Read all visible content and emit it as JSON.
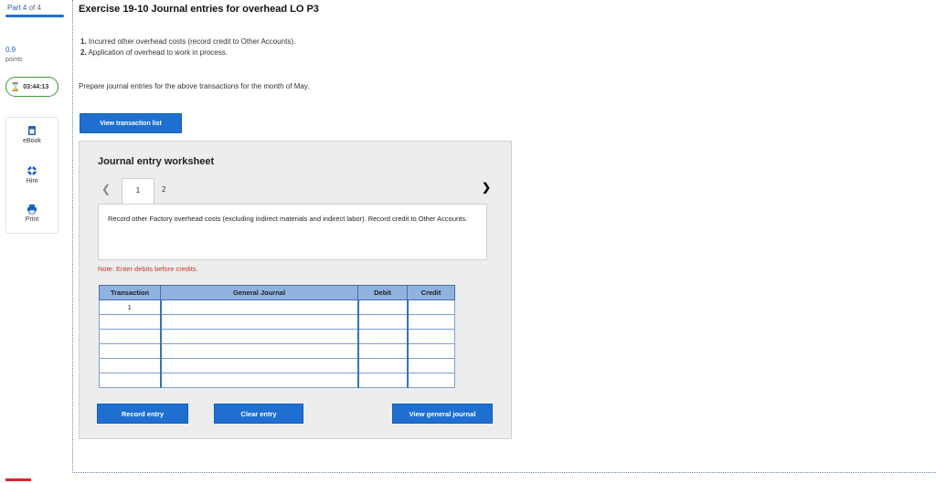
{
  "sidebar": {
    "part_prefix": "Part 4",
    "part_suffix": "of 4",
    "points_value": "0.9",
    "points_label": "points",
    "timer": "03:44:13",
    "progress_fraction": 1.0,
    "tools": [
      {
        "label": "eBook",
        "icon": "book-icon"
      },
      {
        "label": "Hint",
        "icon": "lifebuoy-icon"
      },
      {
        "label": "Print",
        "icon": "printer-icon"
      }
    ]
  },
  "main": {
    "title": "Exercise 19-10 Journal entries for overhead LO P3",
    "instructions": [
      {
        "num": "1.",
        "text": "Incurred other overhead costs (record credit to Other Accounts)."
      },
      {
        "num": "2.",
        "text": "Application of overhead to work in process."
      }
    ],
    "prompt": "Prepare journal entries for the above transactions for the month of May.",
    "view_transaction_label": "View transaction list"
  },
  "worksheet": {
    "title": "Journal entry worksheet",
    "tabs": [
      "1",
      "2"
    ],
    "description": "Record other Factory overhead costs (excluding indirect materials and indirect labor). Record credit to Other Accounts.",
    "note": "Note: Enter debits before credits.",
    "columns": [
      "Transaction",
      "General Journal",
      "Debit",
      "Credit"
    ],
    "rows": [
      {
        "transaction": "1"
      },
      {
        "transaction": ""
      },
      {
        "transaction": ""
      },
      {
        "transaction": ""
      },
      {
        "transaction": ""
      },
      {
        "transaction": ""
      }
    ],
    "buttons": {
      "record": "Record entry",
      "clear": "Clear entry",
      "view_journal": "View general journal"
    }
  },
  "colors": {
    "accent": "#1f6fd1",
    "table_header": "#8fb2e0",
    "note": "#c0392b",
    "timer_border": "#3a9a3a"
  }
}
